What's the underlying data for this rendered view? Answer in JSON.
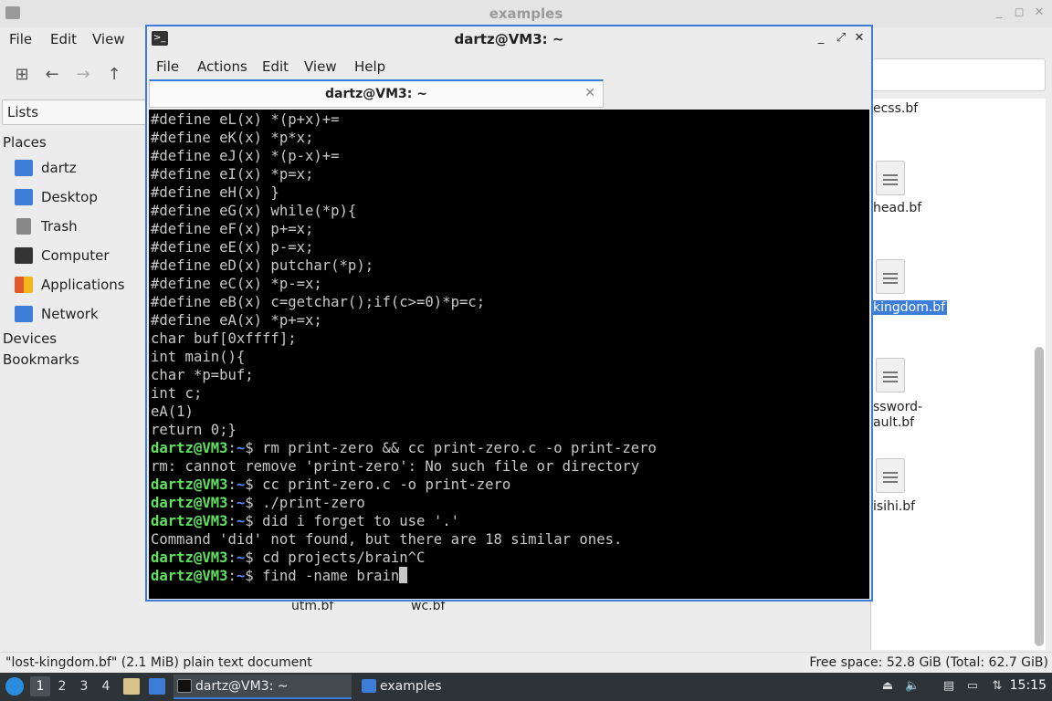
{
  "file_manager": {
    "title": "examples",
    "menu": [
      "File",
      "Edit",
      "View"
    ],
    "side_combo": "Lists",
    "places_header": "Places",
    "places": [
      {
        "label": "dartz",
        "icon": "home-folder-icon",
        "color": "#3d7dd8"
      },
      {
        "label": "Desktop",
        "icon": "desktop-icon",
        "color": "#3d7dd8"
      },
      {
        "label": "Trash",
        "icon": "trash-icon",
        "color": "#888888"
      },
      {
        "label": "Computer",
        "icon": "computer-icon",
        "color": "#333333"
      },
      {
        "label": "Applications",
        "icon": "applications-icon",
        "color": "#e05a2b"
      },
      {
        "label": "Network",
        "icon": "network-icon",
        "color": "#3d7dd8"
      }
    ],
    "devices_header": "Devices",
    "bookmarks_header": "Bookmarks",
    "files": [
      {
        "label": "ecss.bf",
        "selected": false
      },
      {
        "label": "head.bf",
        "selected": false
      },
      {
        "label": "kingdom.bf",
        "selected": true
      },
      {
        "label": "ssword-",
        "label2": "ault.bf",
        "selected": false
      },
      {
        "label": "isihi.bf",
        "selected": false
      }
    ],
    "lower_files": [
      "utm.bf",
      "wc.bf"
    ],
    "status_left": "\"lost-kingdom.bf\" (2.1 MiB) plain text document",
    "status_right": "Free space: 52.8 GiB (Total: 62.7 GiB)"
  },
  "terminal": {
    "title": "dartz@VM3: ~",
    "menu": [
      "File",
      "Actions",
      "Edit",
      "View",
      "Help"
    ],
    "tab_label": "dartz@VM3: ~",
    "prompt_user": "dartz@VM3",
    "prompt_sep": ":",
    "prompt_path": "~",
    "prompt_end": "$ ",
    "lines": [
      {
        "type": "out",
        "text": "#define eL(x) *(p+x)+="
      },
      {
        "type": "out",
        "text": "#define eK(x) *p*x;"
      },
      {
        "type": "out",
        "text": "#define eJ(x) *(p-x)+="
      },
      {
        "type": "out",
        "text": "#define eI(x) *p=x;"
      },
      {
        "type": "out",
        "text": "#define eH(x) }"
      },
      {
        "type": "out",
        "text": "#define eG(x) while(*p){"
      },
      {
        "type": "out",
        "text": "#define eF(x) p+=x;"
      },
      {
        "type": "out",
        "text": "#define eE(x) p-=x;"
      },
      {
        "type": "out",
        "text": "#define eD(x) putchar(*p);"
      },
      {
        "type": "out",
        "text": "#define eC(x) *p-=x;"
      },
      {
        "type": "out",
        "text": "#define eB(x) c=getchar();if(c>=0)*p=c;"
      },
      {
        "type": "out",
        "text": "#define eA(x) *p+=x;"
      },
      {
        "type": "out",
        "text": "char buf[0xffff];"
      },
      {
        "type": "out",
        "text": "int main(){"
      },
      {
        "type": "out",
        "text": "char *p=buf;"
      },
      {
        "type": "out",
        "text": "int c;"
      },
      {
        "type": "out",
        "text": "eA(1)"
      },
      {
        "type": "out",
        "text": "return 0;}"
      },
      {
        "type": "cmd",
        "text": "rm print-zero && cc print-zero.c -o print-zero"
      },
      {
        "type": "out",
        "text": "rm: cannot remove 'print-zero': No such file or directory"
      },
      {
        "type": "cmd",
        "text": "cc print-zero.c -o print-zero"
      },
      {
        "type": "cmd",
        "text": "./print-zero"
      },
      {
        "type": "cmd",
        "text": "did i forget to use '.'"
      },
      {
        "type": "out",
        "text": "Command 'did' not found, but there are 18 similar ones."
      },
      {
        "type": "cmd",
        "text": "cd projects/brain^C"
      },
      {
        "type": "cmd",
        "text": "find -name brain",
        "cursor": true
      }
    ]
  },
  "taskbar": {
    "workspaces": [
      "1",
      "2",
      "3",
      "4"
    ],
    "active_workspace": "1",
    "tasks": [
      {
        "label": "dartz@VM3: ~",
        "icon": "terminal-icon",
        "active": true
      },
      {
        "label": "examples",
        "icon": "folder-icon",
        "active": false
      }
    ],
    "clock": "15:15"
  }
}
